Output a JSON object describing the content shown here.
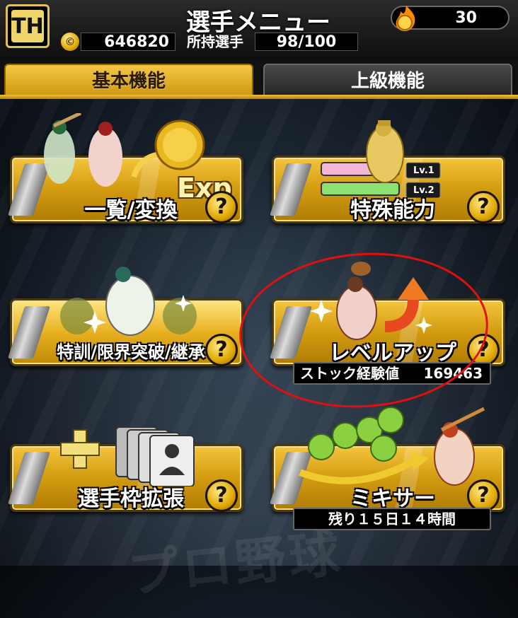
{
  "header": {
    "logo_text": "TH",
    "title": "選手メニュー",
    "energy": "30",
    "coins": "646820",
    "owned_label": "所持選手",
    "owned_value": "98/100"
  },
  "tabs": [
    {
      "label": "基本機能",
      "active": true
    },
    {
      "label": "上級機能",
      "active": false
    }
  ],
  "tiles": [
    {
      "label": "一覧/変換",
      "art_text": "Exp"
    },
    {
      "label": "特殊能力",
      "art_text_1": "Lv.1",
      "art_text_2": "Lv.2"
    },
    {
      "label": "特訓/限界突破/継承"
    },
    {
      "label": "レベルアップ",
      "info_label": "ストック経験値",
      "info_value": "169463"
    },
    {
      "label": "選手枠拡張"
    },
    {
      "label": "ミキサー",
      "info_text": "残り１５日１４時間"
    }
  ],
  "help_label": "?",
  "colors": {
    "gold": "#d29b10",
    "highlight_ring": "#e01010",
    "tab_active": "#f3c744"
  }
}
